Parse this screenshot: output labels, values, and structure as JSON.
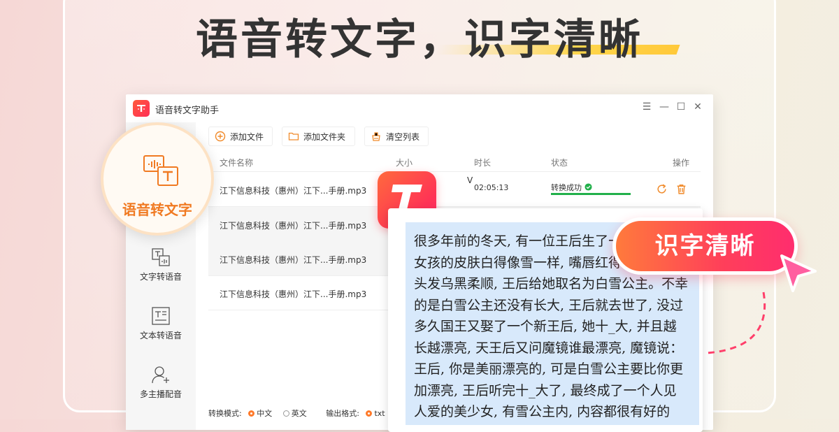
{
  "headline": {
    "text": "语音转文字，识字清晰"
  },
  "window": {
    "title": "语音转文字助手",
    "controls": {
      "menu": "☰",
      "minimize": "—",
      "maximize": "☐",
      "close": "✕"
    }
  },
  "toolbar": {
    "add_file": "添加文件",
    "add_folder": "添加文件夹",
    "clear_list": "清空列表"
  },
  "sidebar": {
    "items": [
      {
        "label": "语音转文字",
        "icon": "speech-to-text-icon"
      },
      {
        "label": "文字转语音",
        "icon": "text-to-speech-icon"
      },
      {
        "label": "文本转语音",
        "icon": "document-to-speech-icon"
      },
      {
        "label": "多主播配音",
        "icon": "multi-voice-icon"
      }
    ]
  },
  "table": {
    "headers": {
      "name": "文件名称",
      "size": "大小",
      "duration": "时长",
      "status": "状态",
      "action": "操作"
    },
    "rows": [
      {
        "name": "江下信息科技（惠州）江下...手册.mp3",
        "size_partial": "V",
        "duration": "02:05:13",
        "status": "转换成功",
        "progress": 1.0
      },
      {
        "name": "江下信息科技（惠州）江下...手册.mp3"
      },
      {
        "name": "江下信息科技（惠州）江下...手册.mp3"
      },
      {
        "name": "江下信息科技（惠州）江下...手册.mp3"
      }
    ]
  },
  "bottom": {
    "mode_label": "转换模式:",
    "mode_cn": "中文",
    "mode_en": "英文",
    "format_label": "输出格式:",
    "format_txt": "txt"
  },
  "feature": {
    "label": "语音转文字"
  },
  "text_panel": {
    "content": "很多年前的冬天, 有一位王后生了一个女孩, 个女孩的皮肤白得像雪一样, 嘴唇红得有如苹果, 头发乌黑柔顺, 王后给她取名为白雪公主。不幸的是白雪公主还没有长大, 王后就去世了, 没过多久国王又娶了一个新王后, 她十_大, 并且越长越漂亮, 天王后又问魔镜谁最漂亮, 魔镜说：王后, 你是美丽漂亮的, 可是白雪公主要比你更加漂亮, 王后听完十_大了, 最终成了一个人见人爱的美少女, 有雪公主内, 内容都很有好的"
  },
  "pill": {
    "text": "识字清晰"
  },
  "colors": {
    "accent_orange": "#f07a22",
    "brand_red": "#ff3355",
    "success_green": "#22b04b",
    "highlight_yellow": "#ffd54a"
  }
}
